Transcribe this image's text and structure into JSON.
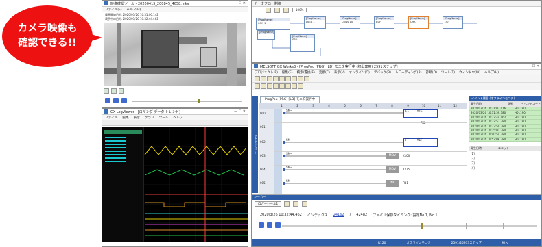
{
  "callout": {
    "line1": "カメラ映像も",
    "line2": "確認できる!!"
  },
  "camera_window": {
    "title": "映像確認ツール - 20200415_200845_4658.mkv",
    "menu": [
      "ファイル(F)",
      "ヘルプ(H)"
    ],
    "info_line1": "録画開始日時: 2020/03/26 10:31:00.142",
    "info_line2": "表示中の日時: 2020/03/26 10:32:44.462"
  },
  "logger_window": {
    "title": "GX LogViewer - [ロギング データ トレンド]",
    "menu": [
      "ファイル",
      "編集",
      "表示",
      "グラフ",
      "ツール",
      "ヘルプ"
    ]
  },
  "flow_window": {
    "title": "データフロー制御",
    "zoom": "100%"
  },
  "flow_blocks": [
    {
      "head": "[ProgName]",
      "body": "CON 1"
    },
    {
      "head": "[ProgName]",
      "body": "DATA 1"
    },
    {
      "head": "[ProgName]",
      "body": "CONV 10"
    },
    {
      "head": "[ProgName]",
      "body": "BUF"
    },
    {
      "head": "[ProgName]",
      "body": "CHK"
    },
    {
      "head": "[ProgName]",
      "body": "OUT"
    },
    {
      "head": "[ProgName]",
      "body": "STO"
    },
    {
      "head": "[ProgName]",
      "body": "---"
    }
  ],
  "gx_window": {
    "title": "MELSOFT GX Works3 - [ProgPou [PRG] [LD] モニタ実行中 (読出専用) 2591ステップ]",
    "menu": [
      "プロジェクト(P)",
      "編集(E)",
      "検索/置換(F)",
      "変換(C)",
      "表示(V)",
      "オンライン(O)",
      "デバッグ(B)",
      "レコーディング(R)",
      "診断(D)",
      "ツール(T)",
      "ウィンドウ(W)",
      "ヘルプ(H)"
    ],
    "tab": "ProgPou [PRG] [LD] モニタ実行中",
    "nav_label": "ナビゲーション",
    "columns": [
      "1",
      "2",
      "3",
      "4",
      "5",
      "6",
      "7",
      "8",
      "9",
      "10",
      "11",
      "12"
    ],
    "step_rows": [
      "000",
      "001",
      "002",
      "003",
      "004",
      "005"
    ],
    "coils": [
      {
        "label": "FF",
        "dev": "Y1F"
      },
      {
        "label": "",
        "dev": "FX2"
      },
      {
        "label": "FF",
        "dev": "Y1F"
      },
      {
        "label": "MOV",
        "dev": "K100"
      },
      {
        "label": "MOV",
        "dev": "K275"
      },
      {
        "label": "INC",
        "dev": "FD1"
      }
    ],
    "contacts": [
      "SM~",
      "SM~",
      "SM~",
      "SM~",
      "SM~"
    ]
  },
  "event_panel": {
    "title": "イベント履歴 (オフラインモニタ)",
    "headers": [
      "発生日時",
      "状態",
      "イベントコード"
    ],
    "rows": [
      {
        "time": "2020/03/26 10:31:03.016",
        "code": "H01190"
      },
      {
        "time": "2020/03/26 10:31:59.780",
        "code": "H01190"
      },
      {
        "time": "2020/03/26 10:32:44.462",
        "code": "H01190"
      },
      {
        "time": "2020/03/26 10:32:57.780",
        "code": "H01190"
      },
      {
        "time": "2020/03/26 10:33:50.780",
        "code": "H01190"
      },
      {
        "time": "2020/03/26 10:35:01.780",
        "code": "H01190"
      },
      {
        "time": "2020/03/26 10:40:54.780",
        "code": "H01190"
      },
      {
        "time": "2020/03/26 10:52:08.780",
        "code": "H01190"
      }
    ],
    "detail_header": "発生日時",
    "detail_col": "ユニット",
    "detail_rows": [
      "[1]",
      "[2]",
      "[3]",
      "[4]"
    ]
  },
  "seeker": {
    "title": "シーカー",
    "logger_label": "ロガーセール1",
    "time": "2020/3/26 10:32:44.462",
    "index_label": "インデックス",
    "index": "24162",
    "slash": "/",
    "total": "42482",
    "file_label": "ファイル保存タイミング: 設定No.1, No.1"
  },
  "statusbar": {
    "step": "R120",
    "mode": "オフラインモニタ",
    "steps": "2591/25913ステップ",
    "insert": "挿入"
  },
  "colors": {
    "callout": "#e11111",
    "trend_bg": "#000000",
    "selection": "#2348b8"
  },
  "icons": [
    "play-icon",
    "stop-icon",
    "rewind-icon",
    "forward-icon",
    "back-icon",
    "next-icon"
  ]
}
